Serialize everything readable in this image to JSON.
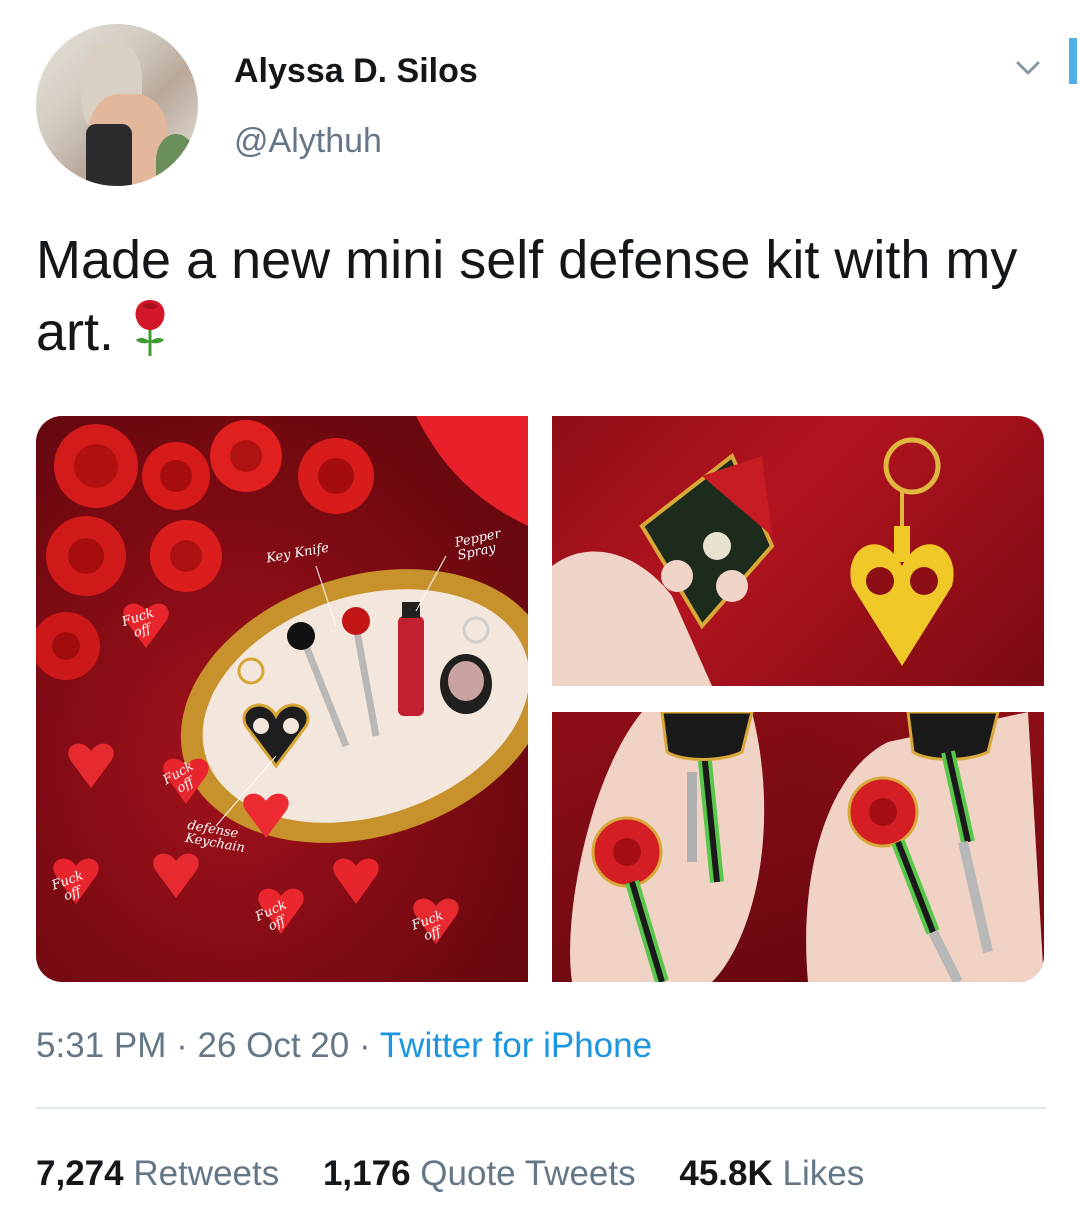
{
  "author": {
    "name": "Alyssa D. Silos",
    "handle": "@Alythuh"
  },
  "tweet": {
    "text": "Made a new mini self defense kit with my art.",
    "emoji": "rose-icon"
  },
  "media": {
    "image_1": {
      "labels": {
        "key_knife": "Key Knife",
        "pepper_spray": "Pepper\nSpray",
        "defense_keychain": "defense\nKeychain"
      },
      "heart_text": "Fuck\noff"
    }
  },
  "meta": {
    "time": "5:31 PM",
    "separator": "·",
    "date": "26 Oct 20",
    "source": "Twitter for iPhone"
  },
  "stats": [
    {
      "count": "7,274",
      "label": "Retweets"
    },
    {
      "count": "1,176",
      "label": "Quote Tweets"
    },
    {
      "count": "45.8K",
      "label": "Likes"
    }
  ],
  "colors": {
    "text_primary": "#14171a",
    "text_secondary": "#657786",
    "link": "#1b95e0",
    "divider": "#e1e8ed"
  }
}
